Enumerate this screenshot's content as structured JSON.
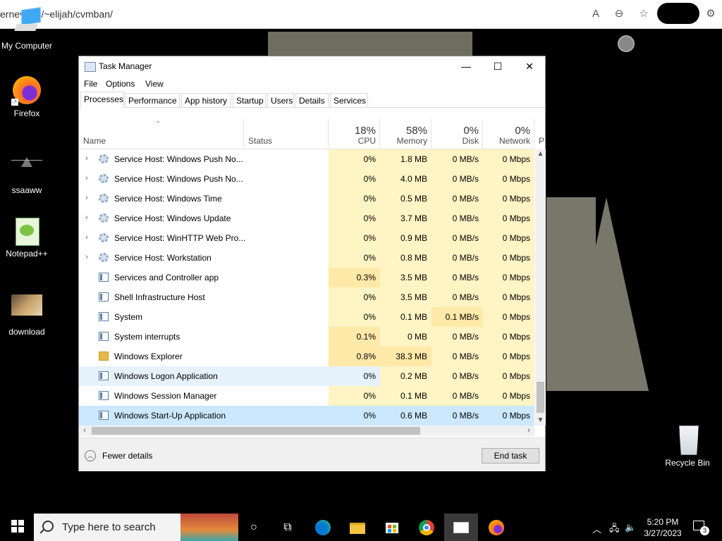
{
  "browser": {
    "url": "ernev   om/~elijah/cvmban/",
    "icons": [
      "read-aloud-icon",
      "zoom-out-icon",
      "favorites-icon",
      "extensions-icon"
    ]
  },
  "desktop": {
    "icons": [
      {
        "label": "My Computer"
      },
      {
        "label": "Firefox"
      },
      {
        "label": "ssaaww"
      },
      {
        "label": "Notepad++"
      },
      {
        "label": "download"
      },
      {
        "label": "Recycle Bin"
      }
    ]
  },
  "task_manager": {
    "title": "Task Manager",
    "menu": [
      "File",
      "Options",
      "View"
    ],
    "tabs": [
      "Processes",
      "Performance",
      "App history",
      "Startup",
      "Users",
      "Details",
      "Services"
    ],
    "active_tab": "Processes",
    "columns": {
      "name": "Name",
      "status": "Status",
      "cpu": {
        "pct": "18%",
        "label": "CPU"
      },
      "memory": {
        "pct": "58%",
        "label": "Memory"
      },
      "disk": {
        "pct": "0%",
        "label": "Disk"
      },
      "network": {
        "pct": "0%",
        "label": "Network"
      },
      "power_partial": "P"
    },
    "rows": [
      {
        "name": "Service Host: Windows Push No...",
        "expandable": true,
        "icon": "gear",
        "cpu": "0%",
        "memory": "1.8 MB",
        "disk": "0 MB/s",
        "network": "0 Mbps"
      },
      {
        "name": "Service Host: Windows Push No...",
        "expandable": true,
        "icon": "gear",
        "cpu": "0%",
        "memory": "4.0 MB",
        "disk": "0 MB/s",
        "network": "0 Mbps"
      },
      {
        "name": "Service Host: Windows Time",
        "expandable": true,
        "icon": "gear",
        "cpu": "0%",
        "memory": "0.5 MB",
        "disk": "0 MB/s",
        "network": "0 Mbps"
      },
      {
        "name": "Service Host: Windows Update",
        "expandable": true,
        "icon": "gear",
        "cpu": "0%",
        "memory": "3.7 MB",
        "disk": "0 MB/s",
        "network": "0 Mbps"
      },
      {
        "name": "Service Host: WinHTTP Web Pro...",
        "expandable": true,
        "icon": "gear",
        "cpu": "0%",
        "memory": "0.9 MB",
        "disk": "0 MB/s",
        "network": "0 Mbps"
      },
      {
        "name": "Service Host: Workstation",
        "expandable": true,
        "icon": "gear",
        "cpu": "0%",
        "memory": "0.8 MB",
        "disk": "0 MB/s",
        "network": "0 Mbps"
      },
      {
        "name": "Services and Controller app",
        "expandable": false,
        "icon": "win",
        "cpu": "0.3%",
        "memory": "3.5 MB",
        "disk": "0 MB/s",
        "network": "0 Mbps"
      },
      {
        "name": "Shell Infrastructure Host",
        "expandable": false,
        "icon": "win",
        "cpu": "0%",
        "memory": "3.5 MB",
        "disk": "0 MB/s",
        "network": "0 Mbps"
      },
      {
        "name": "System",
        "expandable": false,
        "icon": "win",
        "cpu": "0%",
        "memory": "0.1 MB",
        "disk": "0.1 MB/s",
        "network": "0 Mbps"
      },
      {
        "name": "System interrupts",
        "expandable": false,
        "icon": "win",
        "cpu": "0.1%",
        "memory": "0 MB",
        "disk": "0 MB/s",
        "network": "0 Mbps"
      },
      {
        "name": "Windows Explorer",
        "expandable": false,
        "icon": "folder",
        "cpu": "0.8%",
        "memory": "38.3 MB",
        "disk": "0 MB/s",
        "network": "0 Mbps"
      },
      {
        "name": "Windows Logon Application",
        "expandable": false,
        "icon": "win",
        "cpu": "0%",
        "memory": "0.2 MB",
        "disk": "0 MB/s",
        "network": "0 Mbps",
        "state": "hover"
      },
      {
        "name": "Windows Session Manager",
        "expandable": false,
        "icon": "win",
        "cpu": "0%",
        "memory": "0.1 MB",
        "disk": "0 MB/s",
        "network": "0 Mbps"
      },
      {
        "name": "Windows Start-Up Application",
        "expandable": false,
        "icon": "win",
        "cpu": "0%",
        "memory": "0.6 MB",
        "disk": "0 MB/s",
        "network": "0 Mbps",
        "state": "selected"
      }
    ],
    "fewer_details": "Fewer details",
    "end_task": "End task"
  },
  "taskbar": {
    "search_placeholder": "Type here to search",
    "apps": [
      "cortana-icon",
      "task-view-icon",
      "edge-icon",
      "file-explorer-icon",
      "store-icon",
      "chrome-icon",
      "task-manager-icon",
      "firefox-icon"
    ],
    "time": "5:20 PM",
    "date": "3/27/2023",
    "notification_count": "3"
  },
  "colors": {
    "heat_light": "#fff4c4",
    "heat_medium": "#ffe9a8",
    "heat_strong": "#f9ecb0",
    "selected": "#cce8ff",
    "hover": "#e5f1fb"
  }
}
